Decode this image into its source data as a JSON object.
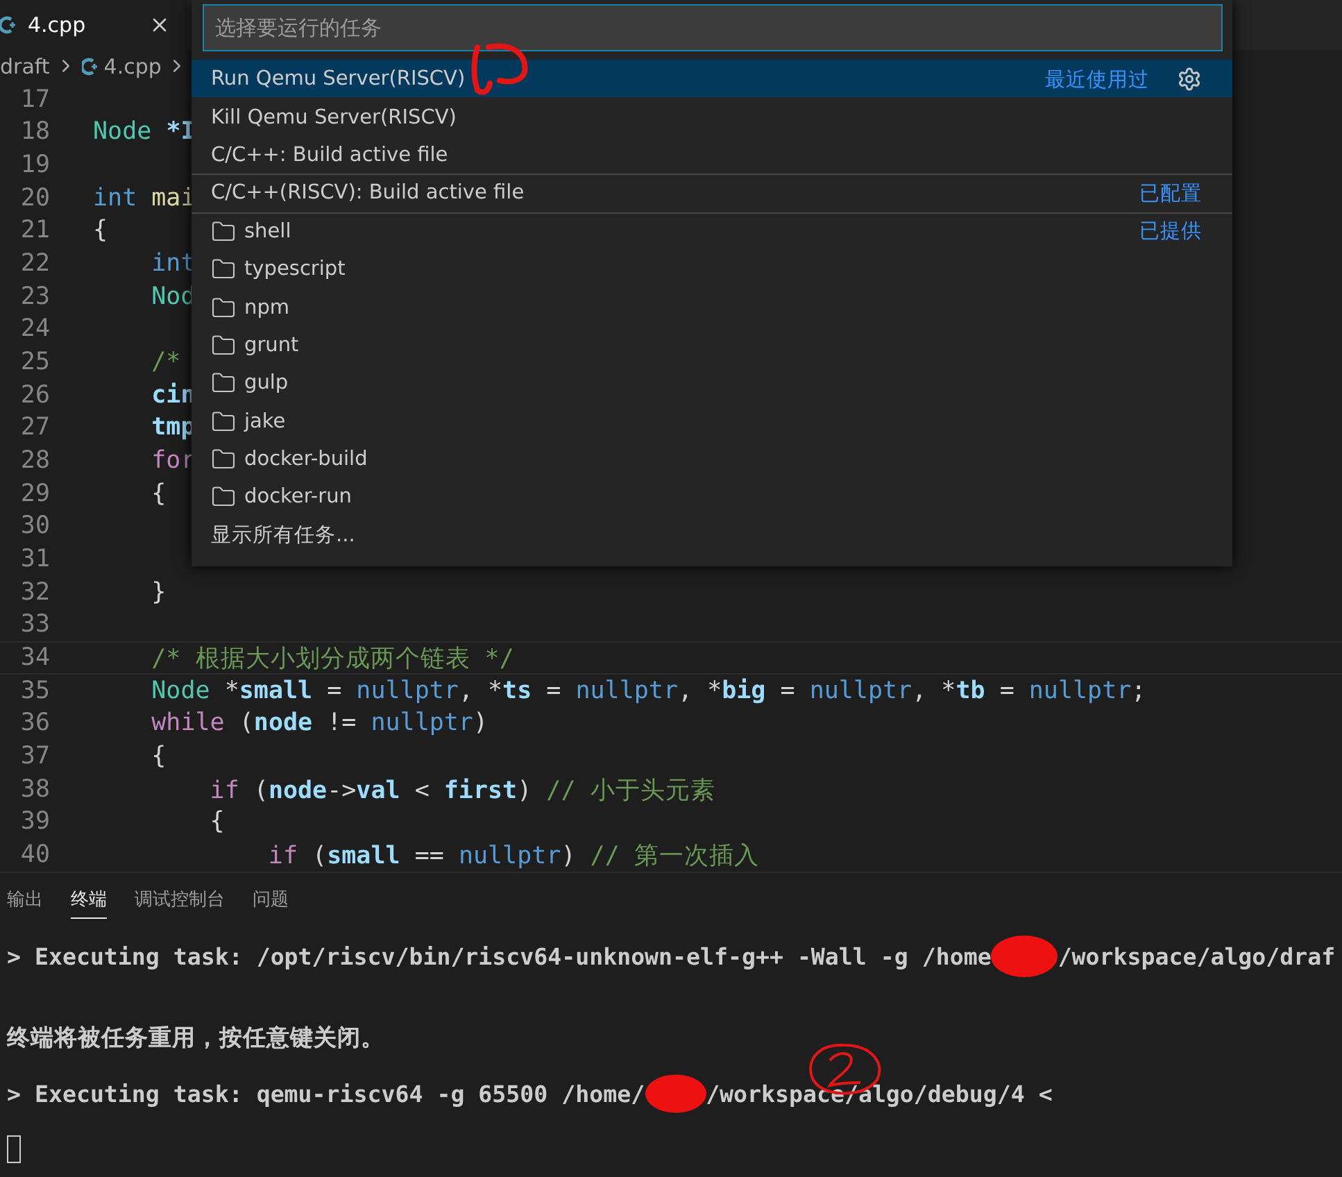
{
  "editor_tabs": [
    {
      "label": "4.cpp",
      "selected": true
    }
  ],
  "breadcrumb": {
    "folder": "draft",
    "file": "4.cpp"
  },
  "quick_pick": {
    "placeholder": "选择要运行的任务",
    "items": [
      {
        "label": "Run Qemu Server(RISCV)",
        "kind": "task",
        "selected": true,
        "separator_above": false,
        "group_label": "最近使用过"
      },
      {
        "label": "Kill Qemu Server(RISCV)",
        "kind": "task",
        "selected": false,
        "separator_above": false
      },
      {
        "label": "C/C++: Build active file",
        "kind": "task",
        "selected": false,
        "separator_above": false
      },
      {
        "label": "C/C++(RISCV): Build active file",
        "kind": "task",
        "selected": false,
        "separator_above": true,
        "group_label": "已配置"
      },
      {
        "label": "shell",
        "kind": "folder",
        "selected": false,
        "separator_above": true,
        "group_label": "已提供"
      },
      {
        "label": "typescript",
        "kind": "folder",
        "selected": false,
        "separator_above": false
      },
      {
        "label": "npm",
        "kind": "folder",
        "selected": false,
        "separator_above": false
      },
      {
        "label": "grunt",
        "kind": "folder",
        "selected": false,
        "separator_above": false
      },
      {
        "label": "gulp",
        "kind": "folder",
        "selected": false,
        "separator_above": false
      },
      {
        "label": "jake",
        "kind": "folder",
        "selected": false,
        "separator_above": false
      },
      {
        "label": "docker-build",
        "kind": "folder",
        "selected": false,
        "separator_above": false
      },
      {
        "label": "docker-run",
        "kind": "folder",
        "selected": false,
        "separator_above": false
      },
      {
        "label": "显示所有任务...",
        "kind": "action",
        "selected": false,
        "separator_above": false
      }
    ]
  },
  "code_lines": [
    {
      "number": "17",
      "current": false
    },
    {
      "number": "18",
      "current": false,
      "tokens": [
        {
          "text": "Node",
          "kind": "type"
        },
        {
          "text": " *I",
          "kind": "variable"
        }
      ]
    },
    {
      "number": "19",
      "current": false
    },
    {
      "number": "20",
      "current": false,
      "tokens": [
        {
          "text": "int",
          "kind": "keyword"
        },
        {
          "text": " mai",
          "kind": "function"
        }
      ]
    },
    {
      "number": "21",
      "current": false,
      "tokens": [
        {
          "text": "{",
          "kind": "plain"
        }
      ]
    },
    {
      "number": "22",
      "current": false,
      "tokens": [
        {
          "text": "    int",
          "kind": "keyword"
        }
      ]
    },
    {
      "number": "23",
      "current": false,
      "tokens": [
        {
          "text": "    Nod",
          "kind": "type"
        }
      ]
    },
    {
      "number": "24",
      "current": false
    },
    {
      "number": "25",
      "current": false,
      "tokens": [
        {
          "text": "    /*",
          "kind": "comment"
        }
      ]
    },
    {
      "number": "26",
      "current": false,
      "tokens": [
        {
          "text": "    cin",
          "kind": "variable"
        }
      ]
    },
    {
      "number": "27",
      "current": false,
      "tokens": [
        {
          "text": "    tmp",
          "kind": "variable"
        }
      ]
    },
    {
      "number": "28",
      "current": false,
      "tokens": [
        {
          "text": "    for",
          "kind": "control"
        }
      ]
    },
    {
      "number": "29",
      "current": false,
      "tokens": [
        {
          "text": "    {",
          "kind": "plain"
        }
      ]
    },
    {
      "number": "30",
      "current": false
    },
    {
      "number": "31",
      "current": false
    },
    {
      "number": "32",
      "current": false,
      "tokens": [
        {
          "text": "    }",
          "kind": "plain"
        }
      ]
    },
    {
      "number": "33",
      "current": false
    },
    {
      "number": "34",
      "current": true,
      "tokens": [
        {
          "text": "    /* 根据大小划分成两个链表 */",
          "kind": "comment"
        }
      ]
    },
    {
      "number": "35",
      "current": false,
      "tokens": [
        {
          "text": "    Node",
          "kind": "type"
        },
        {
          "text": " *",
          "kind": "plain"
        },
        {
          "text": "small",
          "kind": "variable"
        },
        {
          "text": " = ",
          "kind": "plain"
        },
        {
          "text": "nullptr",
          "kind": "keyword"
        },
        {
          "text": ", *",
          "kind": "plain"
        },
        {
          "text": "ts",
          "kind": "variable"
        },
        {
          "text": " = ",
          "kind": "plain"
        },
        {
          "text": "nullptr",
          "kind": "keyword"
        },
        {
          "text": ", *",
          "kind": "plain"
        },
        {
          "text": "big",
          "kind": "variable"
        },
        {
          "text": " = ",
          "kind": "plain"
        },
        {
          "text": "nullptr",
          "kind": "keyword"
        },
        {
          "text": ", *",
          "kind": "plain"
        },
        {
          "text": "tb",
          "kind": "variable"
        },
        {
          "text": " = ",
          "kind": "plain"
        },
        {
          "text": "nullptr",
          "kind": "keyword"
        },
        {
          "text": ";",
          "kind": "plain"
        }
      ]
    },
    {
      "number": "36",
      "current": false,
      "tokens": [
        {
          "text": "    while",
          "kind": "control"
        },
        {
          "text": " (",
          "kind": "plain"
        },
        {
          "text": "node",
          "kind": "variable"
        },
        {
          "text": " != ",
          "kind": "plain"
        },
        {
          "text": "nullptr",
          "kind": "keyword"
        },
        {
          "text": ")",
          "kind": "plain"
        }
      ]
    },
    {
      "number": "37",
      "current": false,
      "tokens": [
        {
          "text": "    {",
          "kind": "plain"
        }
      ]
    },
    {
      "number": "38",
      "current": false,
      "tokens": [
        {
          "text": "        if",
          "kind": "control"
        },
        {
          "text": " (",
          "kind": "plain"
        },
        {
          "text": "node",
          "kind": "variable"
        },
        {
          "text": "->",
          "kind": "plain"
        },
        {
          "text": "val",
          "kind": "variable"
        },
        {
          "text": " < ",
          "kind": "plain"
        },
        {
          "text": "first",
          "kind": "variable"
        },
        {
          "text": ") ",
          "kind": "plain"
        },
        {
          "text": "// 小于头元素",
          "kind": "comment"
        }
      ]
    },
    {
      "number": "39",
      "current": false,
      "tokens": [
        {
          "text": "        {",
          "kind": "plain"
        }
      ]
    },
    {
      "number": "40",
      "current": false,
      "tokens": [
        {
          "text": "            if",
          "kind": "control"
        },
        {
          "text": " (",
          "kind": "plain"
        },
        {
          "text": "small",
          "kind": "variable"
        },
        {
          "text": " == ",
          "kind": "plain"
        },
        {
          "text": "nullptr",
          "kind": "keyword"
        },
        {
          "text": ") ",
          "kind": "plain"
        },
        {
          "text": "// 第一次插入",
          "kind": "comment"
        }
      ]
    }
  ],
  "panel_tabs": [
    {
      "label": "输出",
      "selected": false
    },
    {
      "label": "终端",
      "selected": true
    },
    {
      "label": "调试控制台",
      "selected": false
    },
    {
      "label": "问题",
      "selected": false
    }
  ],
  "terminal_lines": [
    {
      "kind": "command",
      "parts": [
        {
          "kind": "text",
          "text": "> Executing task: /opt/riscv/bin/riscv64-unknown-elf-g++ -Wall -g /home"
        },
        {
          "kind": "redaction"
        },
        {
          "kind": "text",
          "text": "/workspace/algo/draf"
        }
      ]
    },
    {
      "kind": "message",
      "parts": [
        {
          "kind": "text",
          "text": "终端将被任务重用，按任意键关闭。"
        }
      ]
    },
    {
      "kind": "command",
      "parts": [
        {
          "kind": "text",
          "text": "> Executing task: qemu-riscv64 -g 65500 /home/"
        },
        {
          "kind": "redaction"
        },
        {
          "kind": "text",
          "text": "/workspace/algo/debug/4 <"
        }
      ]
    },
    {
      "kind": "cursor"
    }
  ]
}
